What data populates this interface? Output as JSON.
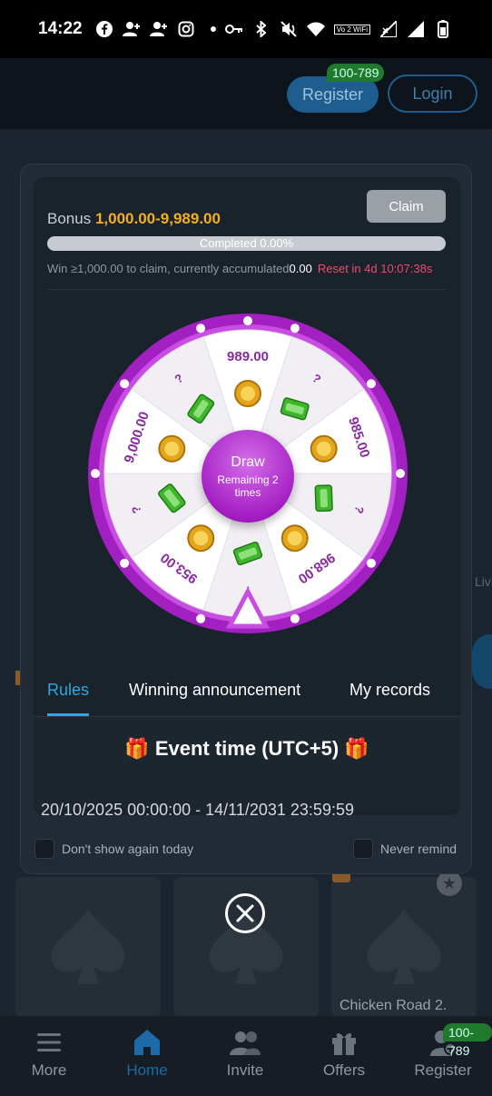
{
  "status_bar": {
    "time": "14:22",
    "wifi_tag": "Vo 2 WiFi"
  },
  "header": {
    "register_label": "Register",
    "login_label": "Login",
    "badge": "100-789"
  },
  "modal": {
    "bonus_label": "Bonus",
    "bonus_range": "1,000.00-9,989.00",
    "claim_label": "Claim",
    "progress_label": "Completed 0.00%",
    "progress_fraction": 0.0,
    "claim_note": "Win ≥1,000.00 to claim, currently accumulated",
    "accumulated": "0.00",
    "reset_text": "Reset in 4d 10:07:38s",
    "wheel": {
      "segment_labels": [
        "989.00",
        "?",
        "985.00",
        "?",
        "968.00",
        "?",
        "953.00",
        "?",
        "9,000.00",
        "?"
      ],
      "draw_label": "Draw",
      "remaining_label": "Remaining 2 times"
    },
    "tabs": [
      {
        "label": "Rules",
        "active": true
      },
      {
        "label": "Winning announcement",
        "active": false
      },
      {
        "label": "My records",
        "active": false
      }
    ],
    "event_title": "Event time (UTC+5)",
    "event_range": "20/10/2025 00:00:00 - 14/11/2031 23:59:59",
    "dont_show_label": "Don't show again today",
    "never_remind_label": "Never remind"
  },
  "background": {
    "card_label": "Chicken Road 2.",
    "live_label": "Liv"
  },
  "bottom_nav": {
    "items": [
      {
        "label": "More",
        "icon": "menu-icon",
        "active": false
      },
      {
        "label": "Home",
        "icon": "home-icon",
        "active": true
      },
      {
        "label": "Invite",
        "icon": "people-icon",
        "active": false
      },
      {
        "label": "Offers",
        "icon": "gift-icon",
        "active": false
      },
      {
        "label": "Register",
        "icon": "add-user-icon",
        "active": false
      }
    ],
    "badge": "100-789"
  },
  "colors": {
    "accent_blue": "#2ea8e0",
    "bonus_gold": "#f0b021",
    "reset_red": "#ef4c6b",
    "wheel_purple": "#b12fd0"
  }
}
